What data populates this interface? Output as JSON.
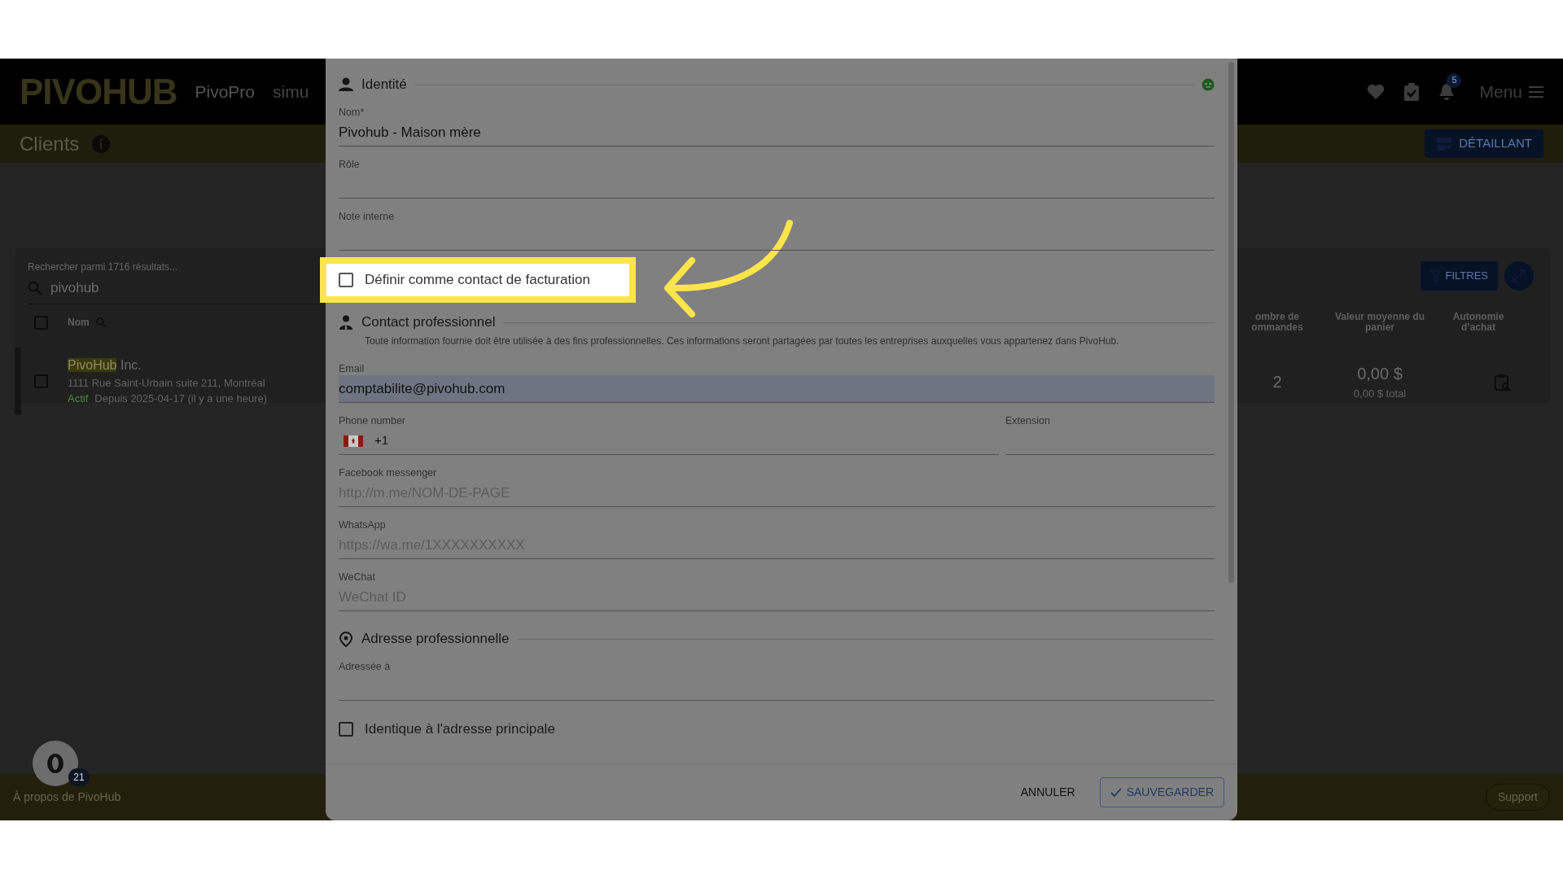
{
  "navbar": {
    "logo": "PIVOHUB",
    "items": [
      "PivoPro",
      "simu"
    ],
    "notifications_badge": "5",
    "menu_label": "Menu"
  },
  "page_header": {
    "title": "Clients",
    "action_button": "DÉTAILLANT"
  },
  "client_list": {
    "search_label": "Rechercher parmi 1716 résultats...",
    "search_value": "pivohub",
    "all_selected": false,
    "filters_button": "FILTRES",
    "columns": [
      "Nom",
      "ombre de ommandes",
      "Valeur moyenne du panier",
      "Autonomie d’achat"
    ],
    "rows": [
      {
        "selected": false,
        "name_parts": [
          {
            "text": "PivoHub",
            "highlighted": true
          },
          {
            "text": " Inc.",
            "highlighted": false
          }
        ],
        "address": "1111 Rue Saint-Urbain suite 211, Montréal",
        "status": "Actif",
        "since": "Depuis 2025-04-17 (il y a une heure)",
        "orders": "2",
        "avg_basket": "0,00 $",
        "total": "0,00 $ total"
      }
    ]
  },
  "footer": {
    "about_link": "À propos de PivoHub",
    "support_button": "Support"
  },
  "help_badge": {
    "count": "21"
  },
  "dialog": {
    "items": [
      {
        "kind": "section",
        "title": "Identité"
      },
      {
        "kind": "field",
        "label": "Nom*",
        "value": "Pivohub - Maison mère"
      },
      {
        "kind": "field",
        "label": "Rôle"
      },
      {
        "kind": "field",
        "label": "Note interne"
      },
      {
        "kind": "checkbox",
        "label": "Définir comme contact de facturation",
        "checked": false,
        "highlighted": true
      },
      {
        "kind": "section",
        "title": "Contact professionnel",
        "description": "Toute information fournie doit être utilisée à des fins professionnelles. Ces informations seront partagées par toutes les entreprises auxquelles vous appartenez dans PivoHub."
      },
      {
        "kind": "field",
        "label": "Email",
        "value": "comptabilite@pivohub.com",
        "autofilled": true
      },
      {
        "kind": "phone",
        "label": "Phone number",
        "value": "+1",
        "extension_label": "Extension"
      },
      {
        "kind": "field",
        "label": "Facebook messenger",
        "placeholder": "http://m.me/NOM-DE-PAGE"
      },
      {
        "kind": "field",
        "label": "WhatsApp",
        "placeholder": "https://wa.me/1XXXXXXXXXX"
      },
      {
        "kind": "field",
        "label": "WeChat",
        "placeholder": "WeChat ID"
      },
      {
        "kind": "section",
        "title": "Adresse professionnelle"
      },
      {
        "kind": "field",
        "label": "Adressée à"
      },
      {
        "kind": "checkbox",
        "label": "Identique à l'adresse principale",
        "checked": false,
        "highlighted": false
      }
    ],
    "cancel_button": "ANNULER",
    "save_button": "SAUVEGARDER"
  }
}
